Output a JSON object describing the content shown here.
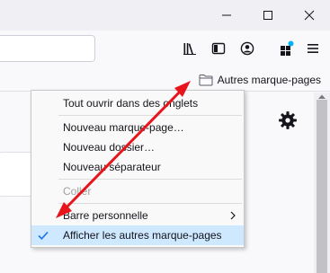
{
  "window": {
    "controls": [
      {
        "name": "minimize-button",
        "icon": "minimize-icon"
      },
      {
        "name": "maximize-button",
        "icon": "maximize-icon"
      },
      {
        "name": "close-button",
        "icon": "close-icon"
      }
    ]
  },
  "toolbar": {
    "icons": [
      "library-icon",
      "sidebar-icon",
      "account-icon",
      "extensions-icon",
      "menu-icon"
    ],
    "extension_badge_color": "#00b3f4"
  },
  "bookmarks_bar": {
    "other_bookmarks_label": "Autres marque-pages",
    "folder_icon": "folder-icon"
  },
  "context_menu": {
    "items": [
      {
        "label": "Tout ouvrir dans des onglets",
        "disabled": false
      },
      {
        "label": "Nouveau marque-page…",
        "disabled": false
      },
      {
        "label": "Nouveau dossier…",
        "disabled": false
      },
      {
        "label": "Nouveau séparateur",
        "disabled": false
      },
      {
        "label": "Coller",
        "disabled": true
      },
      {
        "label": "Barre personnelle",
        "submenu": true
      },
      {
        "label": "Afficher les autres marque-pages",
        "checked": true,
        "highlighted": true
      }
    ],
    "highlight_color": "#cde8ff",
    "check_color": "#1a73e8"
  },
  "annotation": {
    "arrow_color": "#e8141c"
  },
  "page": {
    "settings_icon": "gear-icon"
  }
}
